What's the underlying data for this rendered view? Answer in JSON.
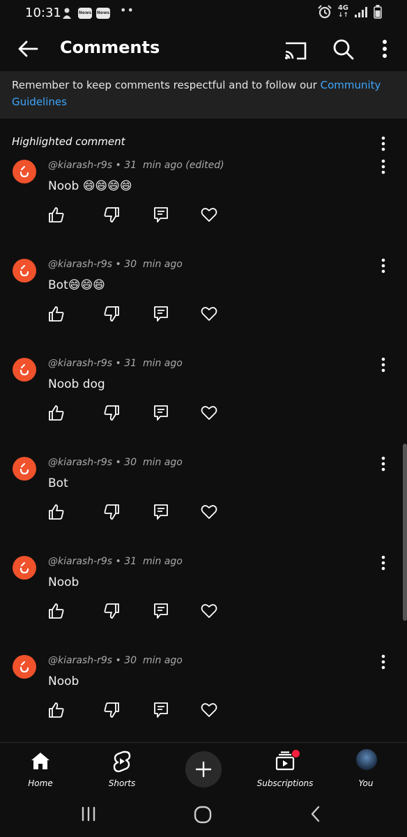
{
  "status_bar": {
    "time": "10:31",
    "news_badges": [
      "News",
      "News"
    ],
    "dots": "••",
    "network": "4G",
    "icons": [
      "android-settings-icon",
      "news-icon",
      "news-icon",
      "alarm-icon",
      "signal-icon",
      "battery-icon"
    ]
  },
  "header": {
    "title": "Comments",
    "icons": [
      "back-arrow-icon",
      "cast-icon",
      "search-icon",
      "more-vertical-icon"
    ]
  },
  "notice": {
    "text": "Remember to keep comments respectful and to follow our ",
    "link": "Community Guidelines"
  },
  "highlighted_label": "Highlighted comment",
  "comments": [
    {
      "meta": "@kiarash-r9s • 31  min ago (edited)",
      "text": "Noob 😄😄😄😄"
    },
    {
      "meta": "@kiarash-r9s • 30  min ago",
      "text": "Bot😄😄😄"
    },
    {
      "meta": "@kiarash-r9s • 31  min ago",
      "text": "Noob dog"
    },
    {
      "meta": "@kiarash-r9s • 30  min ago",
      "text": "Bot"
    },
    {
      "meta": "@kiarash-r9s • 31  min ago",
      "text": "Noob"
    },
    {
      "meta": "@kiarash-r9s • 30  min ago",
      "text": "Noob"
    }
  ],
  "comment_actions": [
    "like-icon",
    "dislike-icon",
    "reply-icon",
    "heart-icon"
  ],
  "bottom_nav": [
    {
      "label": "Home",
      "icon": "home-icon"
    },
    {
      "label": "Shorts",
      "icon": "shorts-icon"
    },
    {
      "label": "",
      "icon": "create-plus-icon"
    },
    {
      "label": "Subscriptions",
      "icon": "subscriptions-icon"
    },
    {
      "label": "You",
      "icon": "profile-avatar"
    }
  ],
  "system_nav": [
    "recent-apps-icon",
    "home-button-icon",
    "back-icon"
  ],
  "colors": {
    "background": "#0f0f0f",
    "notice_background": "#212121",
    "link": "#3ea6ff",
    "avatar": "#f0522c",
    "notification_dot": "#ff1f3d"
  }
}
